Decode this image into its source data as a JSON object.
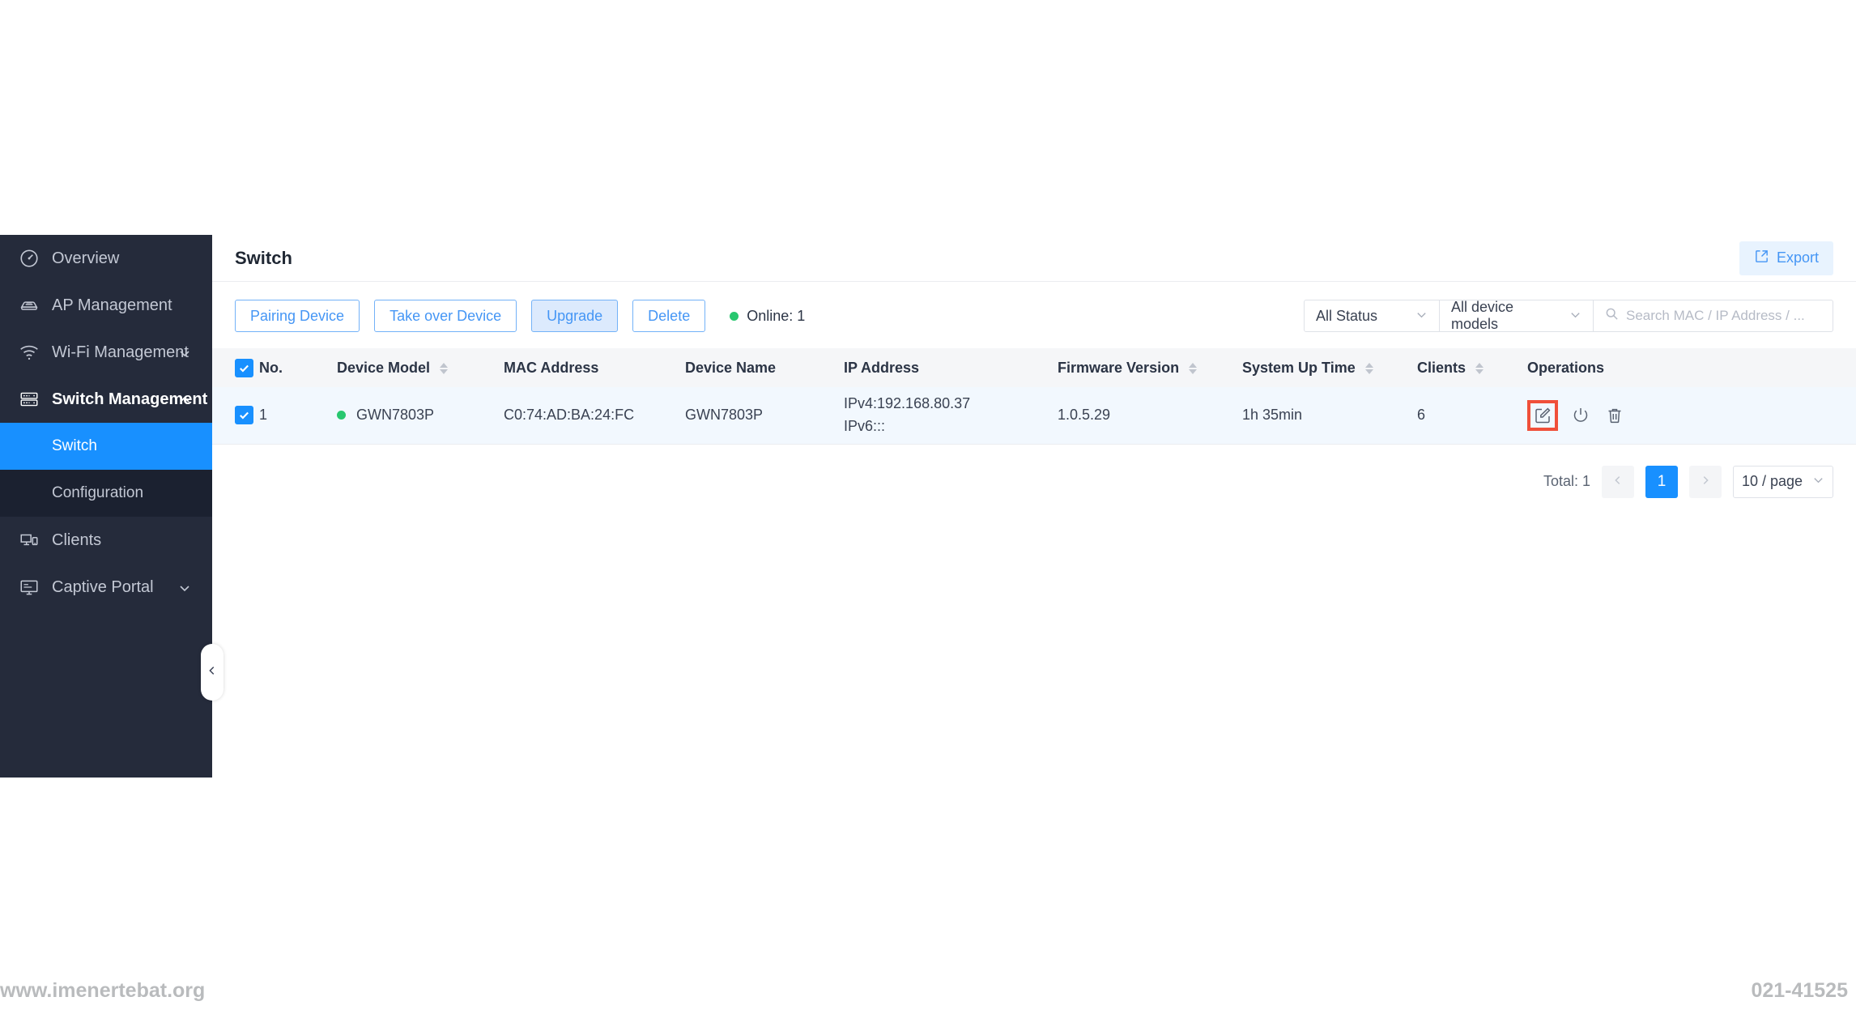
{
  "sidebar": {
    "items": [
      {
        "label": "Overview",
        "icon": "speedometer-icon",
        "has_chevron": false
      },
      {
        "label": "AP Management",
        "icon": "access-point-icon",
        "has_chevron": false
      },
      {
        "label": "Wi-Fi Management",
        "icon": "wifi-icon",
        "has_chevron": true,
        "chevron": "down"
      },
      {
        "label": "Switch Management",
        "icon": "switch-rack-icon",
        "has_chevron": true,
        "chevron": "up",
        "active": true
      },
      {
        "label": "Clients",
        "icon": "devices-icon",
        "has_chevron": false
      },
      {
        "label": "Captive Portal",
        "icon": "portal-monitor-icon",
        "has_chevron": true,
        "chevron": "down"
      }
    ],
    "subitems": [
      {
        "label": "Switch",
        "selected": true
      },
      {
        "label": "Configuration",
        "selected": false
      }
    ],
    "collapse_icon": "chevron-left-icon",
    "bg_color": "#252b3b",
    "accent_color": "#1890ff"
  },
  "header": {
    "title": "Switch",
    "export_label": "Export",
    "export_icon": "external-link-icon"
  },
  "toolbar": {
    "buttons": [
      {
        "label": "Pairing Device",
        "pressed": false
      },
      {
        "label": "Take over Device",
        "pressed": false
      },
      {
        "label": "Upgrade",
        "pressed": true
      },
      {
        "label": "Delete",
        "pressed": false
      }
    ],
    "online_status": "Online: 1",
    "online_dot_color": "#28c76f"
  },
  "filters": {
    "status_select": {
      "value": "All Status",
      "icon": "chevron-down-icon"
    },
    "model_select": {
      "value": "All device models",
      "icon": "chevron-down-icon"
    },
    "search": {
      "placeholder": "Search MAC / IP Address / ...",
      "value": "",
      "icon": "search-icon"
    }
  },
  "table": {
    "select_all_checked": true,
    "columns": [
      {
        "label": "No.",
        "sortable": false
      },
      {
        "label": "Device Model",
        "sortable": true
      },
      {
        "label": "MAC Address",
        "sortable": false
      },
      {
        "label": "Device Name",
        "sortable": false
      },
      {
        "label": "IP Address",
        "sortable": false
      },
      {
        "label": "Firmware Version",
        "sortable": true
      },
      {
        "label": "System Up Time",
        "sortable": true
      },
      {
        "label": "Clients",
        "sortable": true
      },
      {
        "label": "Operations",
        "sortable": false
      }
    ],
    "rows": [
      {
        "checked": true,
        "no": "1",
        "status_dot_color": "#28c76f",
        "device_model": "GWN7803P",
        "mac_address": "C0:74:AD:BA:24:FC",
        "device_name": "GWN7803P",
        "ipv4": "IPv4:192.168.80.37",
        "ipv6": "IPv6:::",
        "firmware_version": "1.0.5.29",
        "system_up_time": "1h 35min",
        "clients": "6",
        "operations": [
          {
            "icon": "edit-icon",
            "highlighted": true,
            "highlight_color": "#f0503a"
          },
          {
            "icon": "power-icon",
            "highlighted": false
          },
          {
            "icon": "trash-icon",
            "highlighted": false
          }
        ]
      }
    ]
  },
  "pagination": {
    "total_label": "Total: 1",
    "prev_icon": "chevron-left-icon",
    "next_icon": "chevron-right-icon",
    "current_page": "1",
    "page_size": "10 / page",
    "page_size_icon": "chevron-down-icon"
  },
  "watermarks": {
    "left": "www.imenertebat.org",
    "right": "021-41525"
  }
}
